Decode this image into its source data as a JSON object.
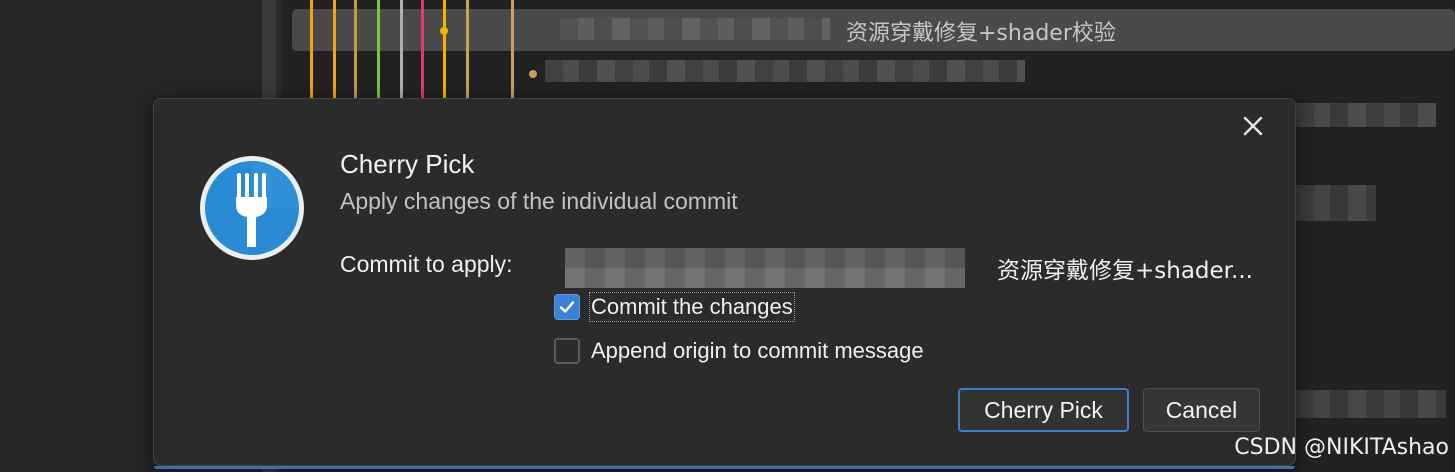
{
  "background": {
    "graph_line_colors": [
      "#f3a213",
      "#f3a213",
      "#c49a45",
      "#7cc43a",
      "#b0b0b0",
      "#e0387a",
      "#f0b400",
      "#c9a060",
      "#c9a060"
    ],
    "commit_row_text": "资源穿戴修复+shader校验",
    "watermark": "CSDN @NIKITAshao"
  },
  "dialog": {
    "close_icon": "close-icon",
    "app_icon": "fork-icon",
    "title": "Cherry Pick",
    "subtitle": "Apply changes of the individual commit",
    "commit_label": "Commit to apply:",
    "commit_value": "资源穿戴修复+shader...",
    "options": [
      {
        "label": "Commit the changes",
        "checked": true
      },
      {
        "label": "Append origin to commit message",
        "checked": false
      }
    ],
    "primary_button": "Cherry Pick",
    "cancel_button": "Cancel",
    "accent_color": "#3b82d6"
  }
}
